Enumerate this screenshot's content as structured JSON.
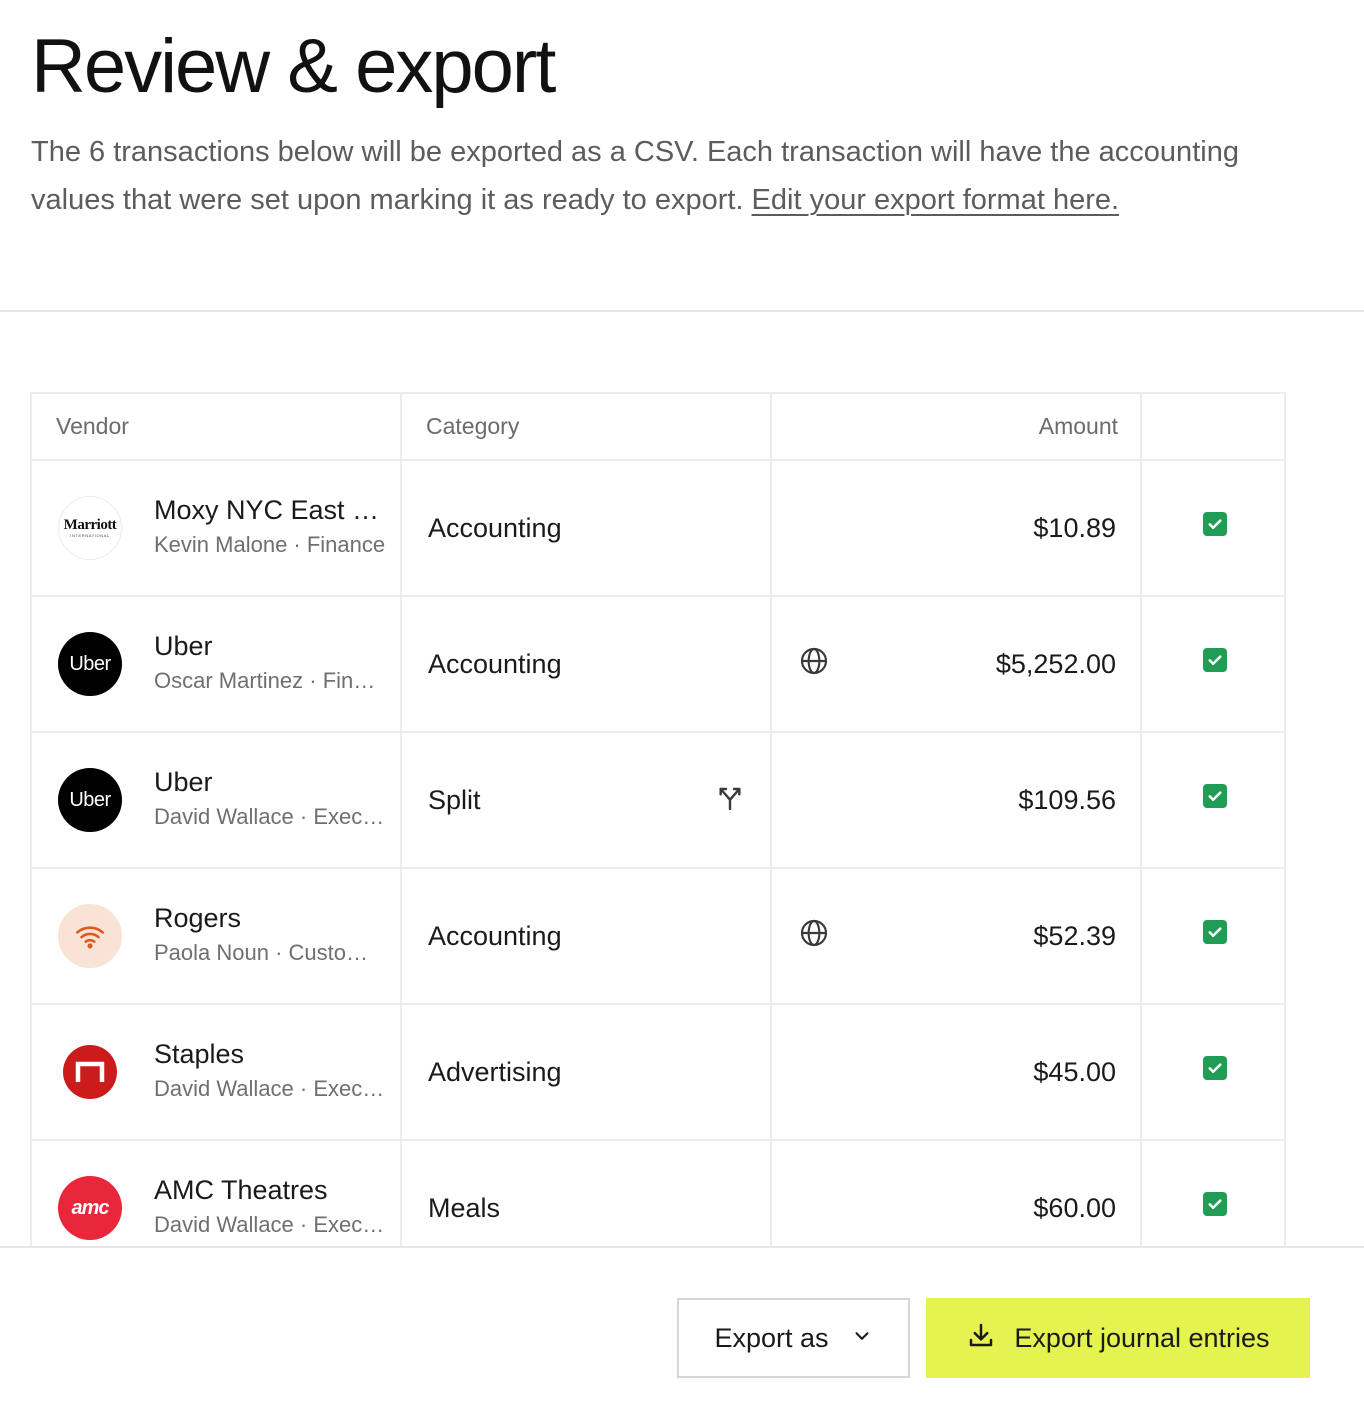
{
  "header": {
    "title": "Review & export",
    "description": "The 6 transactions below will be exported as a CSV. Each transaction will have the accounting values that were set upon marking it as ready to export. ",
    "edit_link": "Edit your export format here."
  },
  "table": {
    "columns": {
      "vendor": "Vendor",
      "category": "Category",
      "amount": "Amount"
    },
    "rows": [
      {
        "logo": "marriott-logo",
        "logo_text": "Marriott",
        "logo_sub": "INTERNATIONAL",
        "vendor": "Moxy NYC East Village",
        "sub": "Kevin Malone · Finance",
        "category": "Accounting",
        "category_icon": "",
        "amount_icon": "",
        "amount": "$10.89",
        "checked": true
      },
      {
        "logo": "uber-logo",
        "logo_text": "Uber",
        "vendor": "Uber",
        "sub": "Oscar Martinez · Finance",
        "category": "Accounting",
        "category_icon": "",
        "amount_icon": "globe-icon",
        "amount": "$5,252.00",
        "checked": true
      },
      {
        "logo": "uber-logo",
        "logo_text": "Uber",
        "vendor": "Uber",
        "sub": "David Wallace · Executive",
        "category": "Split",
        "category_icon": "split-icon",
        "amount_icon": "",
        "amount": "$109.56",
        "checked": true
      },
      {
        "logo": "rogers-logo",
        "logo_text": "",
        "vendor": "Rogers",
        "sub": "Paola Noun · Customer Success",
        "category": "Accounting",
        "category_icon": "",
        "amount_icon": "globe-icon",
        "amount": "$52.39",
        "checked": true
      },
      {
        "logo": "staples-logo",
        "logo_text": "",
        "vendor": "Staples",
        "sub": "David Wallace · Executive",
        "category": "Advertising",
        "category_icon": "",
        "amount_icon": "",
        "amount": "$45.00",
        "checked": true
      },
      {
        "logo": "amc-logo",
        "logo_text": "amc",
        "vendor": "AMC Theatres",
        "sub": "David Wallace · Executive",
        "category": "Meals",
        "category_icon": "",
        "amount_icon": "",
        "amount": "$60.00",
        "checked": true
      }
    ]
  },
  "footer": {
    "export_as_label": "Export as",
    "export_primary_label": "Export journal entries"
  },
  "colors": {
    "primary_button": "#e4f34f",
    "checkbox": "#1f9d55",
    "uber": "#000000",
    "amc": "#e8273a",
    "staples": "#cc1b1b",
    "rogers": "#da5a1f"
  }
}
